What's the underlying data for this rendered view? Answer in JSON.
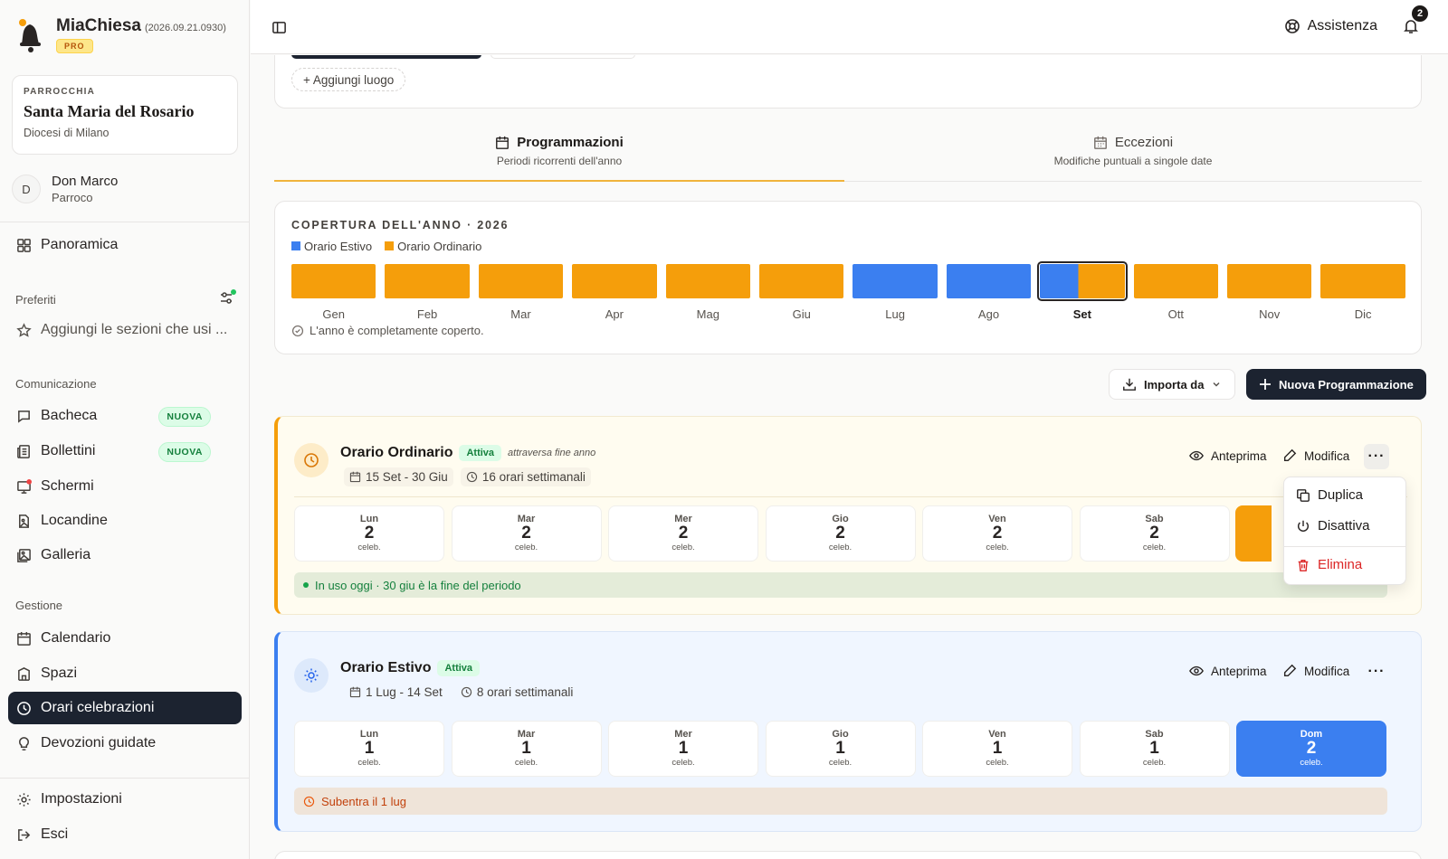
{
  "app": {
    "name": "MiaChiesa",
    "version": "(2026.09.21.0930)",
    "tier": "PRO"
  },
  "parish": {
    "label": "PARROCCHIA",
    "name": "Santa Maria del Rosario",
    "diocese": "Diocesi di Milano"
  },
  "user": {
    "initial": "D",
    "name": "Don Marco",
    "role": "Parroco"
  },
  "nav": {
    "overview": "Panoramica",
    "favorites_title": "Preferiti",
    "favorites_hint": "Aggiungi le sezioni che usi ...",
    "comm_title": "Comunicazione",
    "bacheca": "Bacheca",
    "bollettini": "Bollettini",
    "schermi": "Schermi",
    "locandine": "Locandine",
    "galleria": "Galleria",
    "new_badge": "NUOVA",
    "mgmt_title": "Gestione",
    "calendario": "Calendario",
    "spazi": "Spazi",
    "orari": "Orari celebrazioni",
    "devozioni": "Devozioni guidate",
    "impostazioni": "Impostazioni",
    "esci": "Esci"
  },
  "header": {
    "help": "Assistenza",
    "notif_count": "2"
  },
  "places": {
    "add": "+ Aggiungi luogo"
  },
  "tabs": [
    {
      "label": "Programmazioni",
      "sub": "Periodi ricorrenti dell'anno"
    },
    {
      "label": "Eccezioni",
      "sub": "Modifiche puntuali a singole date"
    }
  ],
  "coverage": {
    "title": "COPERTURA DELL'ANNO · 2026",
    "legend_summer": "Orario Estivo",
    "legend_ordinary": "Orario Ordinario",
    "status": "L'anno è completamente coperto.",
    "months": [
      "Gen",
      "Feb",
      "Mar",
      "Apr",
      "Mag",
      "Giu",
      "Lug",
      "Ago",
      "Set",
      "Ott",
      "Nov",
      "Dic"
    ],
    "colors": {
      "summer": "#3b7ff0",
      "ordinary": "#f59e0b"
    }
  },
  "actions": {
    "import": "Importa da",
    "new": "Nuova Programmazione"
  },
  "schedules": [
    {
      "title": "Orario Ordinario",
      "status": "Attiva",
      "note": "attraversa fine anno",
      "period": "15 Set - 30 Giu",
      "weekly": "16 orari settimanali",
      "preview": "Anteprima",
      "edit": "Modifica",
      "days": [
        {
          "d": "Lun",
          "v": "2"
        },
        {
          "d": "Mar",
          "v": "2"
        },
        {
          "d": "Mer",
          "v": "2"
        },
        {
          "d": "Gio",
          "v": "2"
        },
        {
          "d": "Ven",
          "v": "2"
        },
        {
          "d": "Sab",
          "v": "2"
        }
      ],
      "unit": "celeb.",
      "footer": "In uso oggi · 30 giu è la fine del periodo"
    },
    {
      "title": "Orario Estivo",
      "status": "Attiva",
      "period": "1 Lug - 14 Set",
      "weekly": "8 orari settimanali",
      "preview": "Anteprima",
      "edit": "Modifica",
      "days": [
        {
          "d": "Lun",
          "v": "1"
        },
        {
          "d": "Mar",
          "v": "1"
        },
        {
          "d": "Mer",
          "v": "1"
        },
        {
          "d": "Gio",
          "v": "1"
        },
        {
          "d": "Ven",
          "v": "1"
        },
        {
          "d": "Sab",
          "v": "1"
        },
        {
          "d": "Dom",
          "v": "2"
        }
      ],
      "unit": "celeb.",
      "footer": "Subentra il 1 lug"
    }
  ],
  "menu": {
    "duplicate": "Duplica",
    "disable": "Disattiva",
    "delete": "Elimina"
  }
}
